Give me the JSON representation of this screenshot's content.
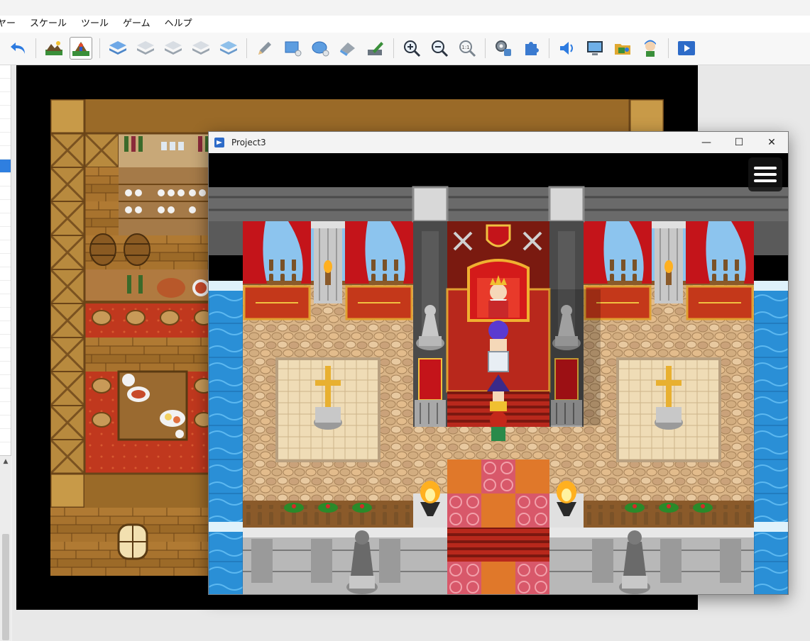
{
  "menubar": {
    "items": [
      "ヤー",
      "スケール",
      "ツール",
      "ゲーム",
      "ヘルプ"
    ]
  },
  "toolbar": {
    "tools": [
      {
        "name": "undo-icon"
      },
      {
        "name": "map-mode-icon"
      },
      {
        "name": "event-mode-icon",
        "active": true
      },
      {
        "name": "layer-1-icon"
      },
      {
        "name": "layer-2-icon"
      },
      {
        "name": "layer-3-icon"
      },
      {
        "name": "layer-4-icon"
      },
      {
        "name": "layer-auto-icon"
      },
      {
        "name": "pencil-icon"
      },
      {
        "name": "rectangle-icon"
      },
      {
        "name": "ellipse-icon"
      },
      {
        "name": "fill-icon"
      },
      {
        "name": "shadow-pen-icon"
      },
      {
        "name": "zoom-in-icon"
      },
      {
        "name": "zoom-out-icon"
      },
      {
        "name": "zoom-actual-icon"
      },
      {
        "name": "database-icon"
      },
      {
        "name": "plugin-manager-icon"
      },
      {
        "name": "sound-test-icon"
      },
      {
        "name": "event-searcher-icon"
      },
      {
        "name": "resource-manager-icon"
      },
      {
        "name": "character-generator-icon"
      },
      {
        "name": "playtest-icon"
      }
    ]
  },
  "game_window": {
    "title": "Project3",
    "minimize": "—",
    "maximize": "☐",
    "close": "✕",
    "menu_button": "menu"
  },
  "colors": {
    "accent": "#2f7fe0",
    "carpet_red": "#b8281c",
    "stone_floor": "#d9b487",
    "water": "#2a8fd6",
    "wood": "#a8732e"
  }
}
